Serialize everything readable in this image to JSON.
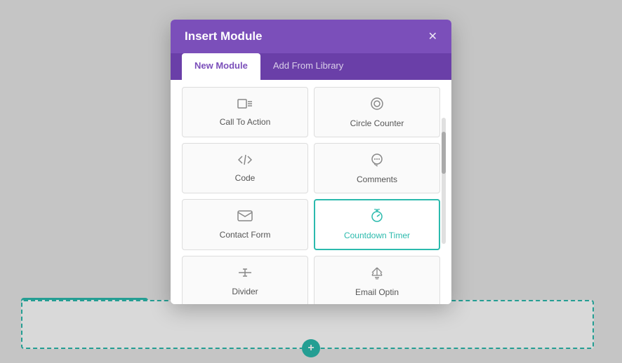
{
  "colors": {
    "purple": "#7b4fba",
    "purple_dark": "#6a3fa8",
    "teal": "#2bbaad",
    "dark": "#2d2d2d"
  },
  "modal": {
    "title": "Insert Module",
    "close_icon": "✕",
    "tabs": [
      {
        "label": "New Module",
        "active": true
      },
      {
        "label": "Add From Library",
        "active": false
      }
    ]
  },
  "modules": [
    {
      "icon": "▶ ≡",
      "label": "Call To Action",
      "unicode": "call-to-action",
      "selected": false
    },
    {
      "icon": "◎",
      "label": "Circle Counter",
      "unicode": "circle-counter",
      "selected": false
    },
    {
      "icon": "</>",
      "label": "Code",
      "unicode": "code",
      "selected": false
    },
    {
      "icon": "💬",
      "label": "Comments",
      "unicode": "comments",
      "selected": false
    },
    {
      "icon": "✉",
      "label": "Contact Form",
      "unicode": "contact-form",
      "selected": false
    },
    {
      "icon": "⏱",
      "label": "Countdown Timer",
      "unicode": "countdown-timer",
      "selected": true
    },
    {
      "icon": "⊕",
      "label": "Divider",
      "unicode": "divider",
      "selected": false
    },
    {
      "icon": "📶",
      "label": "Email Optin",
      "unicode": "email-optin",
      "selected": false
    },
    {
      "icon": "⊞",
      "label": "",
      "unicode": "grid",
      "selected": false
    },
    {
      "icon": "🖼",
      "label": "",
      "unicode": "image",
      "selected": false
    }
  ],
  "toolbar": {
    "icons": [
      "✛",
      "⚙",
      "☐",
      "▦",
      "⏻",
      "🗑"
    ]
  },
  "plus_icon": "+",
  "dark_plus_icon": "+"
}
